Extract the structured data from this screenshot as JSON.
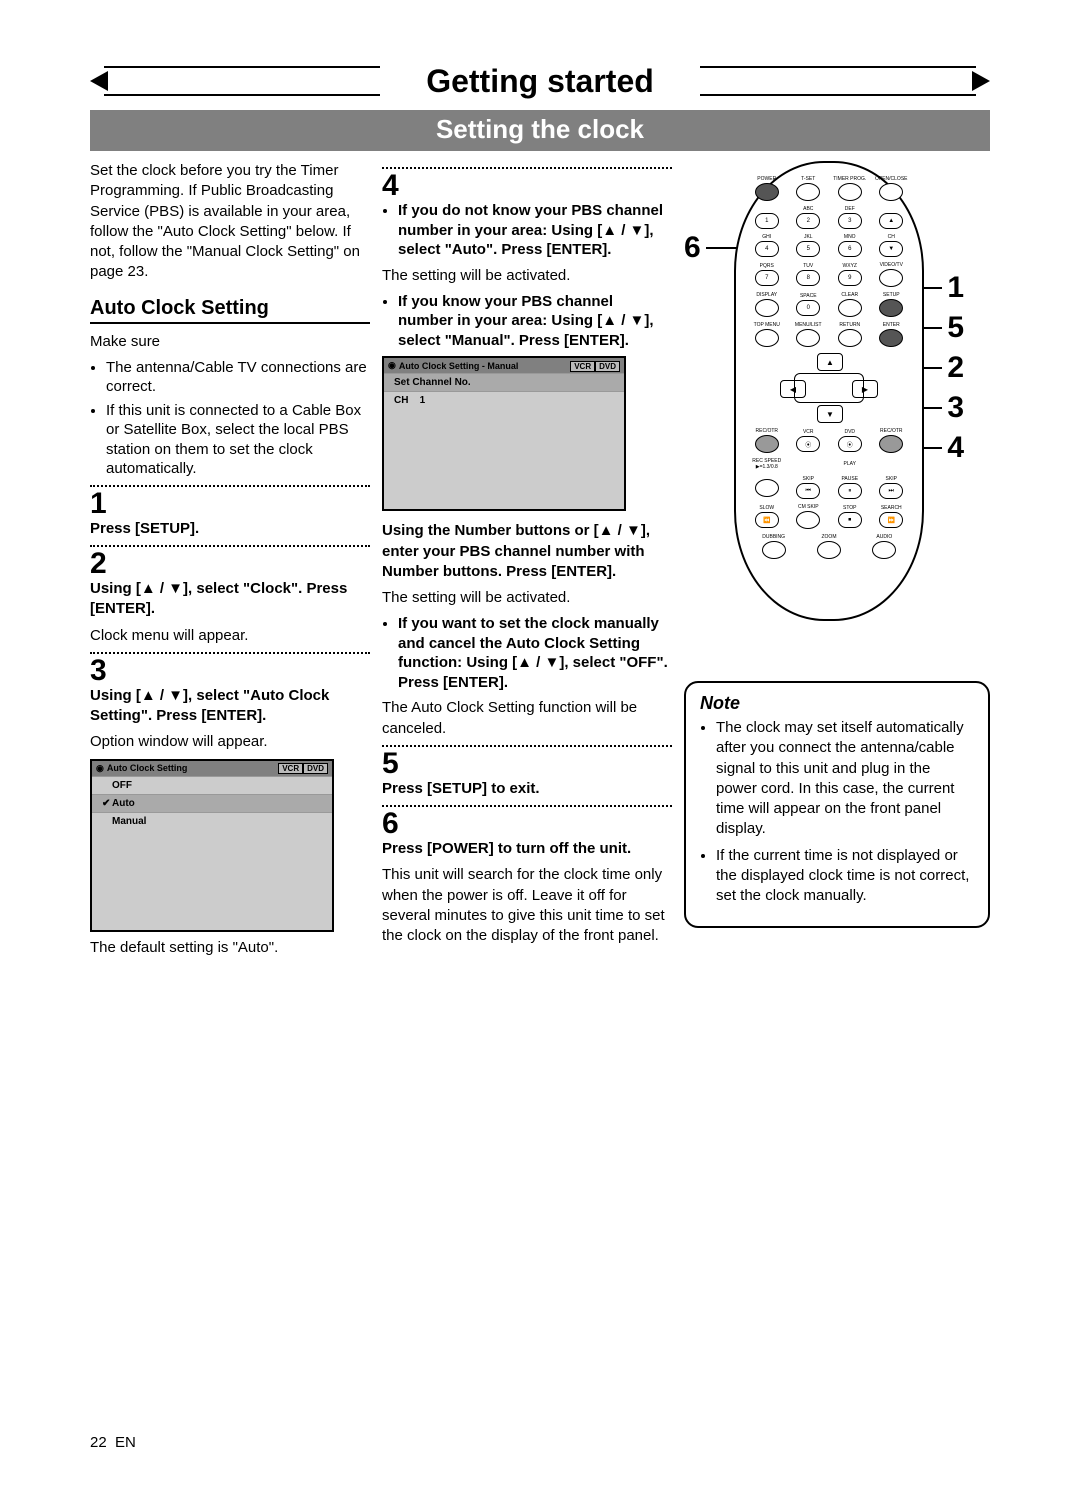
{
  "banner": {
    "title": "Getting started"
  },
  "sub_banner": {
    "title": "Setting the clock"
  },
  "intro": "Set the clock before you try the Timer Programming. If Public Broadcasting Service (PBS) is available in your area, follow the \"Auto Clock Setting\" below. If not, follow the \"Manual Clock Setting\" on page 23.",
  "auto_heading": "Auto Clock Setting",
  "make_sure": "Make sure",
  "make_sure_items": [
    "The antenna/Cable TV connections are correct.",
    "If this unit is connected to a Cable Box or Satellite Box, select the local PBS station on them to set the clock automatically."
  ],
  "step1": {
    "num": "1",
    "text": "Press [SETUP]."
  },
  "step2": {
    "num": "2",
    "bold": "Using [▲ / ▼], select \"Clock\". Press [ENTER].",
    "text": "Clock menu will appear."
  },
  "step3": {
    "num": "3",
    "bold": "Using [▲ / ▼], select \"Auto Clock Setting\". Press [ENTER].",
    "text": "Option window will appear."
  },
  "osd1": {
    "title": "Auto Clock Setting",
    "tab1": "VCR",
    "tab2": "DVD",
    "rows": [
      "OFF",
      "Auto",
      "Manual"
    ]
  },
  "osd1_note": "The default setting is \"Auto\".",
  "step4": {
    "num": "4",
    "a_bold": "If you do not know your PBS channel number in your area: Using [▲ / ▼], select \"Auto\". Press [ENTER].",
    "a_text": "The setting will be activated.",
    "b_bold": "If you know your PBS channel number in your area: Using [▲ / ▼], select \"Manual\". Press [ENTER]."
  },
  "osd2": {
    "title": "Auto Clock Setting - Manual",
    "tab1": "VCR",
    "tab2": "DVD",
    "row1": "Set Channel No.",
    "row2_label": "CH",
    "row2_value": "1"
  },
  "step4c": {
    "bold": "Using the Number buttons or [▲ / ▼], enter your PBS channel number with Number buttons. Press [ENTER].",
    "text": "The setting will be activated."
  },
  "step4d": {
    "bold": "If you want to set the clock manually and cancel the Auto Clock Setting function: Using [▲ / ▼], select \"OFF\". Press [ENTER].",
    "text": "The Auto Clock Setting function will be canceled."
  },
  "step5": {
    "num": "5",
    "text": "Press [SETUP] to exit."
  },
  "step6": {
    "num": "6",
    "bold": "Press [POWER] to turn off the unit.",
    "text": "This unit will search for the clock time only when the power is off. Leave it off for several minutes to give this unit time to set the clock on the display of the front panel."
  },
  "note": {
    "title": "Note",
    "items": [
      "The clock may set itself automatically after you connect the antenna/cable signal to this unit and plug in the power cord. In this case, the current time will appear on the front panel display.",
      "If the current time is not displayed or the displayed clock time is not correct, set the clock manually."
    ]
  },
  "callouts": {
    "c6": "6",
    "c1": "1",
    "c5": "5",
    "c2": "2",
    "c3": "3",
    "c4": "4"
  },
  "remote_labels": {
    "power": "POWER",
    "tset": "T-SET",
    "timer": "TIMER PROG.",
    "open": "OPEN/CLOSE",
    "abc": "ABC",
    "def": "DEF",
    "ghi": "GHI",
    "jkl": "JKL",
    "mno": "MNO",
    "ch": "CH",
    "pqrs": "PQRS",
    "tuv": "TUV",
    "wxyz": "WXYZ",
    "video": "VIDEO/TV",
    "display": "DISPLAY",
    "space": "SPACE",
    "clear": "CLEAR",
    "setup": "SETUP",
    "topmenu": "TOP MENU",
    "menulist": "MENU/LIST",
    "return": "RETURN",
    "enter": "ENTER",
    "recotr": "REC/OTR",
    "vcr": "VCR",
    "dvd": "DVD",
    "recspeed": "REC SPEED",
    "play": "PLAY",
    "skip": "SKIP",
    "pause": "PAUSE",
    "slow": "SLOW",
    "cmskip": "CM SKIP",
    "stop": "STOP",
    "search": "SEARCH",
    "dubbing": "DUBBING",
    "zoom": "ZOOM",
    "audio": "AUDIO"
  },
  "footer": {
    "page": "22",
    "lang": "EN"
  }
}
